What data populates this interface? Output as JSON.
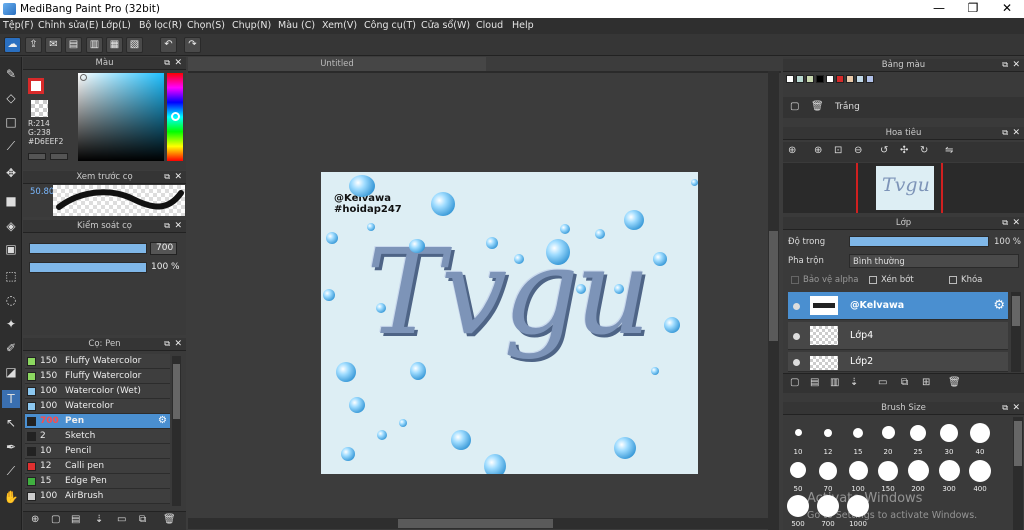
{
  "window": {
    "title": "MediBang Paint Pro (32bit)",
    "minimize": "—",
    "maximize": "❐",
    "close": "✕"
  },
  "menu": [
    "Tệp(F)",
    "Chỉnh sửa(E)",
    "Lớp(L)",
    "Bộ lọc(R)",
    "Chọn(S)",
    "Chụp(N)",
    "Màu (C)",
    "Xem(V)",
    "Công cụ(T)",
    "Cửa sổ(W)",
    "Cloud",
    "Help"
  ],
  "document": {
    "tab_title": "Untitled",
    "watermark_user": "@Kelvawa",
    "watermark_tag": "#hoidap247",
    "lettering": "Tvgu"
  },
  "color_panel": {
    "title": "Màu",
    "r": "R:214",
    "g": "G:238",
    "hex": "#D6EEF2",
    "primary_border": "#d82a2a"
  },
  "brush_preview": {
    "title": "Xem trước cọ",
    "size": "50.80"
  },
  "brush_control": {
    "title": "Kiểm soát cọ",
    "size": "700",
    "opacity": "100 %"
  },
  "brush_list": {
    "title": "Cọ: Pen",
    "items": [
      {
        "size": "150",
        "name": "Fluffy Watercolor",
        "color": "#8cd860"
      },
      {
        "size": "150",
        "name": "Fluffy Watercolor",
        "color": "#8cd860"
      },
      {
        "size": "100",
        "name": "Watercolor (Wet)",
        "color": "#8cc8f0"
      },
      {
        "size": "100",
        "name": "Watercolor",
        "color": "#8cc8f0"
      },
      {
        "size": "700",
        "name": "Pen",
        "color": "#222222"
      },
      {
        "size": "2",
        "name": "Sketch",
        "color": "#222222"
      },
      {
        "size": "10",
        "name": "Pencil",
        "color": "#222222"
      },
      {
        "size": "12",
        "name": "Calli pen",
        "color": "#e03030"
      },
      {
        "size": "15",
        "name": "Edge Pen",
        "color": "#40b040"
      },
      {
        "size": "100",
        "name": "AirBrush",
        "color": "#cccccc"
      }
    ]
  },
  "color_bank": {
    "title": "Bảng màu",
    "label": "Trắng",
    "swatches": [
      "#ffffff",
      "#b8d8d0",
      "#c8d8b0",
      "#000000",
      "#ffffff",
      "#d82a2a",
      "#e8c8a8",
      "#c0d8e8",
      "#b0c0e8"
    ]
  },
  "navigator": {
    "title": "Hoa tiêu"
  },
  "layers": {
    "title": "Lớp",
    "opacity_label": "Độ trong",
    "opacity_value": "100 %",
    "blend_label": "Pha trộn",
    "blend_value": "Bình thường",
    "protect_alpha": "Bảo vệ alpha",
    "clipping": "Xén bớt",
    "lock": "Khóa",
    "items": [
      {
        "name": "@Kelvawa",
        "selected": true
      },
      {
        "name": "Lớp4",
        "selected": false
      },
      {
        "name": "Lớp2",
        "selected": false
      }
    ]
  },
  "brush_size": {
    "title": "Brush Size",
    "row1": [
      "10",
      "12",
      "15",
      "20",
      "25",
      "30",
      "40"
    ],
    "row2": [
      "50",
      "70",
      "100",
      "150",
      "200",
      "300",
      "400"
    ],
    "row3": [
      "500",
      "700",
      "1000"
    ]
  },
  "activation": {
    "line1": "Activate Windows",
    "line2": "Go to Settings to activate Windows."
  }
}
